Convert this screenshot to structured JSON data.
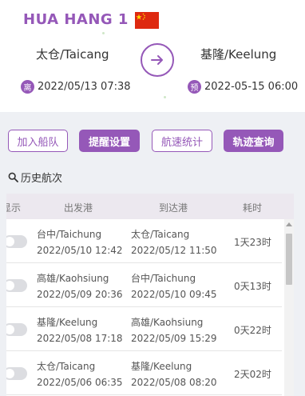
{
  "ship": {
    "name": "HUA HANG 1",
    "flag": "china-flag-icon"
  },
  "route": {
    "from_port": "太仓/Taicang",
    "to_port": "基隆/Keelung",
    "departure_badge": "离",
    "departure_time": "2022/05/13 07:38",
    "eta_badge": "预",
    "eta_time": "2022-05-15 06:00"
  },
  "buttons": {
    "join_fleet": "加入船队",
    "alert_settings": "提醒设置",
    "speed_stats": "航速统计",
    "track_query": "轨迹查询"
  },
  "history": {
    "title": "历史航次",
    "columns": [
      "显示",
      "出发港",
      "到达港",
      "耗时"
    ],
    "rows": [
      {
        "from_port": "台中/Taichung",
        "from_time": "2022/05/10 12:42",
        "to_port": "太仓/Taicang",
        "to_time": "2022/05/12 11:50",
        "duration": "1天23时"
      },
      {
        "from_port": "高雄/Kaohsiung",
        "from_time": "2022/05/09 20:36",
        "to_port": "台中/Taichung",
        "to_time": "2022/05/10 09:45",
        "duration": "0天13时"
      },
      {
        "from_port": "基隆/Keelung",
        "from_time": "2022/05/08 17:18",
        "to_port": "高雄/Kaohsiung",
        "to_time": "2022/05/09 15:29",
        "duration": "0天22时"
      },
      {
        "from_port": "太仓/Taicang",
        "from_time": "2022/05/06 06:35",
        "to_port": "基隆/Keelung",
        "to_time": "2022/05/08 08:20",
        "duration": "2天02时"
      }
    ]
  },
  "colors": {
    "accent": "#9558b8",
    "header_bg": "#ffffff",
    "page_bg": "#eef0f4"
  }
}
